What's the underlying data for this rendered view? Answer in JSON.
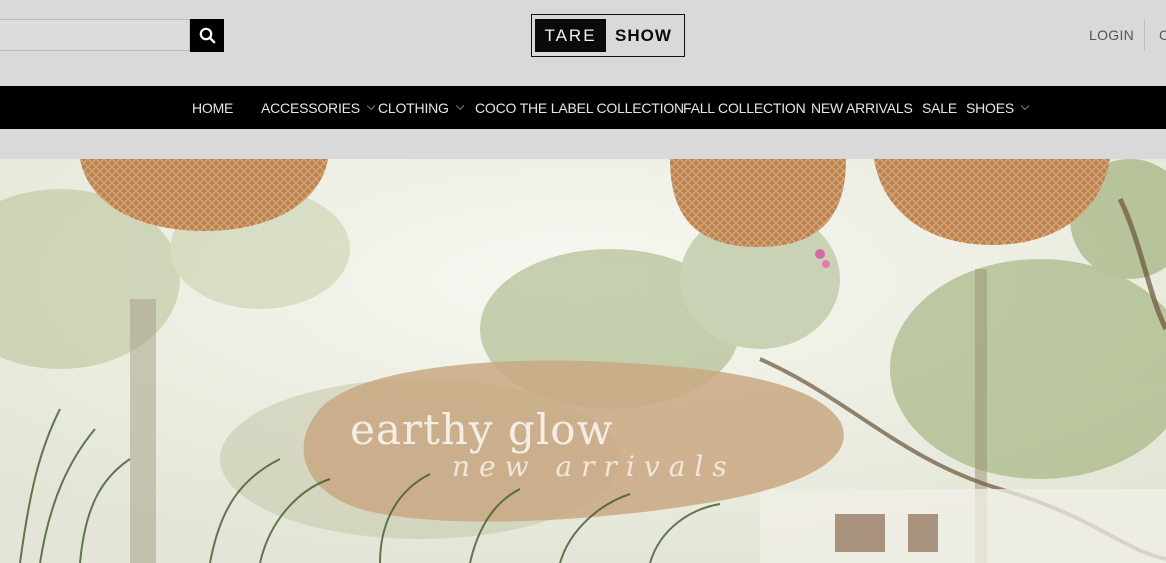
{
  "header": {
    "search": {
      "value": "",
      "placeholder": ""
    },
    "logo": {
      "left_text": "TARE",
      "right_text": "SHOW"
    },
    "login_label": "LOGIN",
    "cart_label": "C"
  },
  "nav": {
    "items": [
      {
        "label": "HOME",
        "has_dropdown": false
      },
      {
        "label": "ACCESSORIES",
        "has_dropdown": true
      },
      {
        "label": "CLOTHING",
        "has_dropdown": true
      },
      {
        "label": "COCO THE LABEL COLLECTION",
        "has_dropdown": false
      },
      {
        "label": "FALL COLLECTION",
        "has_dropdown": false
      },
      {
        "label": "NEW ARRIVALS",
        "has_dropdown": false
      },
      {
        "label": "SALE",
        "has_dropdown": false
      },
      {
        "label": "SHOES",
        "has_dropdown": true
      }
    ]
  },
  "hero": {
    "title": "earthy glow",
    "subtitle": "new arrivals"
  },
  "colors": {
    "page_background": "#d9d9d9",
    "nav_background": "#000000",
    "nav_text": "#e6e6e6",
    "logo_dark": "#0a0a0a",
    "hero_brush": "#c9a883"
  },
  "icons": {
    "search": "search-icon",
    "dropdown": "chevron-down-icon"
  }
}
